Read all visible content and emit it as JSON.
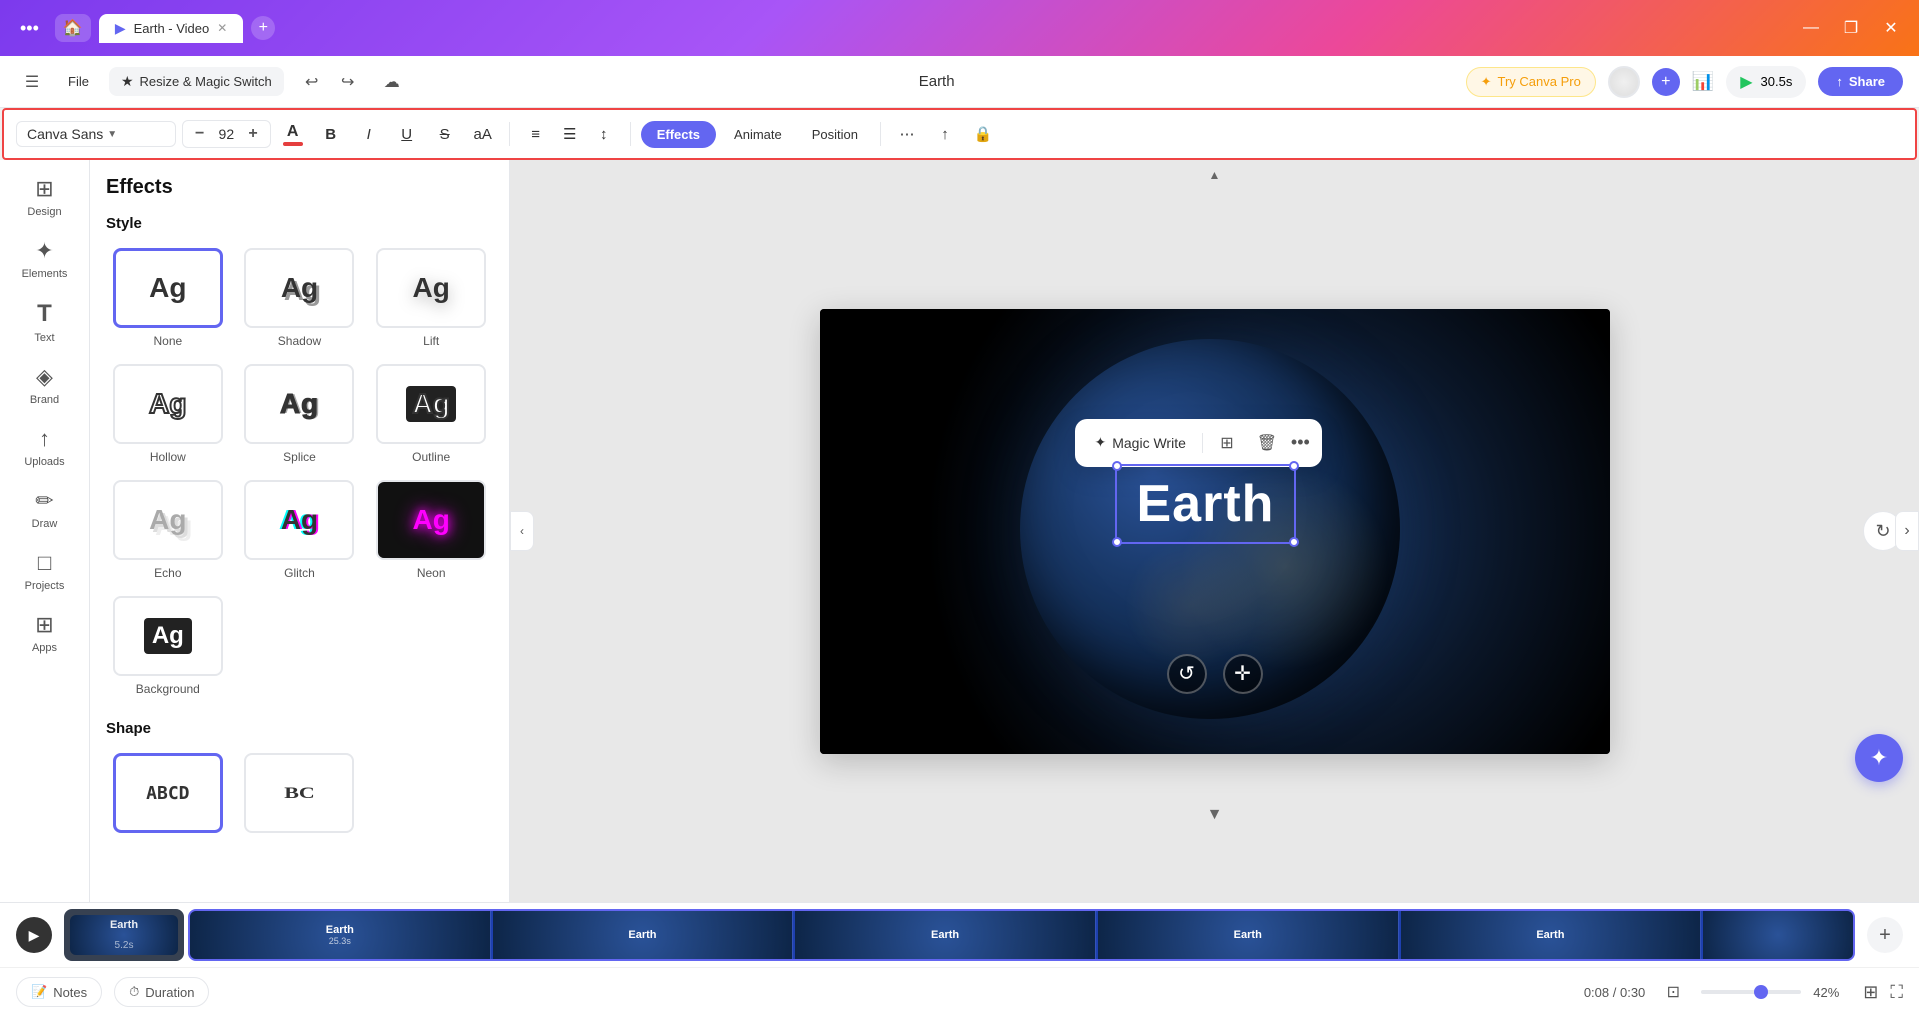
{
  "window": {
    "title": "Earth - Video",
    "tab_title": "Earth - Video"
  },
  "topbar": {
    "dots_label": "•••",
    "tab_name": "Earth - Video",
    "tab_icon": "▶",
    "add_tab": "+",
    "minimize": "—",
    "maximize": "❐",
    "close": "✕"
  },
  "toolbar2": {
    "file_label": "File",
    "magic_switch_label": "Resize & Magic Switch",
    "magic_icon": "★",
    "undo_icon": "↩",
    "redo_icon": "↪",
    "cloud_icon": "☁",
    "project_name": "Earth",
    "try_pro_label": "Try Canva Pro",
    "pro_icon": "✦",
    "play_time": "30.5s",
    "share_label": "Share",
    "share_icon": "↑"
  },
  "format_toolbar": {
    "font_name": "Canva Sans",
    "font_size": "92",
    "decrease_icon": "−",
    "increase_icon": "+",
    "color_icon": "A",
    "bold_icon": "B",
    "italic_icon": "I",
    "underline_icon": "U",
    "strikethrough_icon": "S",
    "case_icon": "aA",
    "align_left": "≡",
    "align_bullets": "☰",
    "align_spacing": "↕",
    "effects_label": "Effects",
    "animate_label": "Animate",
    "position_label": "Position",
    "spacing_icon": "⋯",
    "layer_up": "↑",
    "lock_icon": "🔒"
  },
  "sidebar": {
    "items": [
      {
        "id": "design",
        "icon": "⊞",
        "label": "Design"
      },
      {
        "id": "elements",
        "icon": "✦",
        "label": "Elements"
      },
      {
        "id": "text",
        "icon": "T",
        "label": "Text"
      },
      {
        "id": "brand",
        "icon": "◈",
        "label": "Brand"
      },
      {
        "id": "uploads",
        "icon": "↑",
        "label": "Uploads"
      },
      {
        "id": "draw",
        "icon": "✏",
        "label": "Draw"
      },
      {
        "id": "projects",
        "icon": "□",
        "label": "Projects"
      },
      {
        "id": "apps",
        "icon": "⊞",
        "label": "Apps"
      }
    ]
  },
  "effects_panel": {
    "title": "Effects",
    "style_section": "Style",
    "styles": [
      {
        "id": "none",
        "label": "None",
        "text": "Ag",
        "class": "style-none",
        "selected": true
      },
      {
        "id": "shadow",
        "label": "Shadow",
        "text": "Ag",
        "class": "style-shadow"
      },
      {
        "id": "lift",
        "label": "Lift",
        "text": "Ag",
        "class": "style-lift"
      },
      {
        "id": "hollow",
        "label": "Hollow",
        "text": "Ag",
        "class": "style-hollow"
      },
      {
        "id": "splice",
        "label": "Splice",
        "text": "Ag",
        "class": "style-splice"
      },
      {
        "id": "outline",
        "label": "Outline",
        "text": "Ag",
        "class": "style-outline"
      },
      {
        "id": "echo",
        "label": "Echo",
        "text": "Ag",
        "class": "style-echo"
      },
      {
        "id": "glitch",
        "label": "Glitch",
        "text": "Ag",
        "class": "style-glitch"
      },
      {
        "id": "neon",
        "label": "Neon",
        "text": "Ag",
        "class": "style-neon"
      },
      {
        "id": "background",
        "label": "Background",
        "text": "Ag",
        "class": "style-bg"
      }
    ],
    "shape_section": "Shape",
    "shapes": [
      {
        "id": "curve",
        "label": "",
        "text": "ABCD"
      },
      {
        "id": "arch",
        "label": "",
        "text": "BC"
      }
    ]
  },
  "canvas": {
    "earth_text": "Earth",
    "context_menu": {
      "magic_write": "Magic Write",
      "magic_icon": "✦"
    }
  },
  "timeline": {
    "play_icon": "▶",
    "clips": [
      {
        "label": "Earth",
        "duration": "5.2s"
      },
      {
        "label": "Earth",
        "duration": "25.3s"
      },
      {
        "label": "Earth",
        "duration": ""
      },
      {
        "label": "Earth",
        "duration": ""
      },
      {
        "label": "Earth",
        "duration": ""
      },
      {
        "label": "Earth",
        "duration": ""
      }
    ],
    "add_clip": "+",
    "notes_label": "Notes",
    "duration_label": "Duration",
    "time_current": "0:08",
    "time_total": "0:30",
    "zoom_percent": "42%"
  }
}
